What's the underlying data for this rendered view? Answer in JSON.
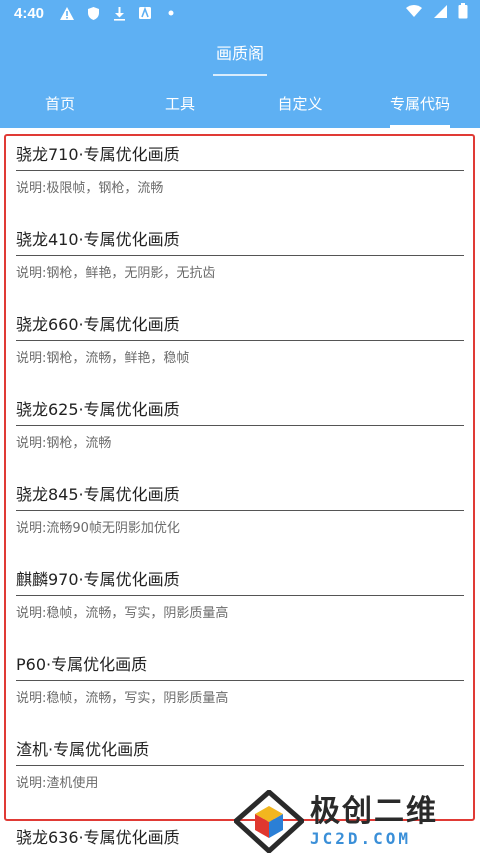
{
  "status_bar": {
    "time": "4:40",
    "left_icons": [
      "warning-icon",
      "shield-icon",
      "download-icon",
      "a-box-icon",
      "dot-icon"
    ],
    "right_icons": [
      "wifi-icon",
      "signal-icon",
      "battery-icon"
    ]
  },
  "app_bar": {
    "title": "画质阁"
  },
  "tabs": [
    {
      "label": "首页",
      "active": false
    },
    {
      "label": "工具",
      "active": false
    },
    {
      "label": "自定义",
      "active": false
    },
    {
      "label": "专属代码",
      "active": true
    }
  ],
  "list": {
    "items": [
      {
        "title": "骁龙710·专属优化画质",
        "desc": "说明:极限帧，钢枪，流畅"
      },
      {
        "title": "骁龙410·专属优化画质",
        "desc": "说明:钢枪，鲜艳，无阴影，无抗齿"
      },
      {
        "title": "骁龙660·专属优化画质",
        "desc": "说明:钢枪，流畅，鲜艳，稳帧"
      },
      {
        "title": "骁龙625·专属优化画质",
        "desc": "说明:钢枪，流畅"
      },
      {
        "title": "骁龙845·专属优化画质",
        "desc": "说明:流畅90帧无阴影加优化"
      },
      {
        "title": "麒麟970·专属优化画质",
        "desc": "说明:稳帧，流畅，写实，阴影质量高"
      },
      {
        "title": "P60·专属优化画质",
        "desc": "说明:稳帧，流畅，写实，阴影质量高"
      },
      {
        "title": "渣机·专属优化画质",
        "desc": "说明:渣机使用"
      },
      {
        "title": "骁龙636·专属优化画质",
        "desc": ""
      }
    ]
  },
  "watermark": {
    "cn": "极创二维",
    "en": "JC2D.COM"
  },
  "colors": {
    "primary": "#5eb0f3",
    "highlight": "#e03a35",
    "watermark_blue": "#3a8fd8"
  }
}
